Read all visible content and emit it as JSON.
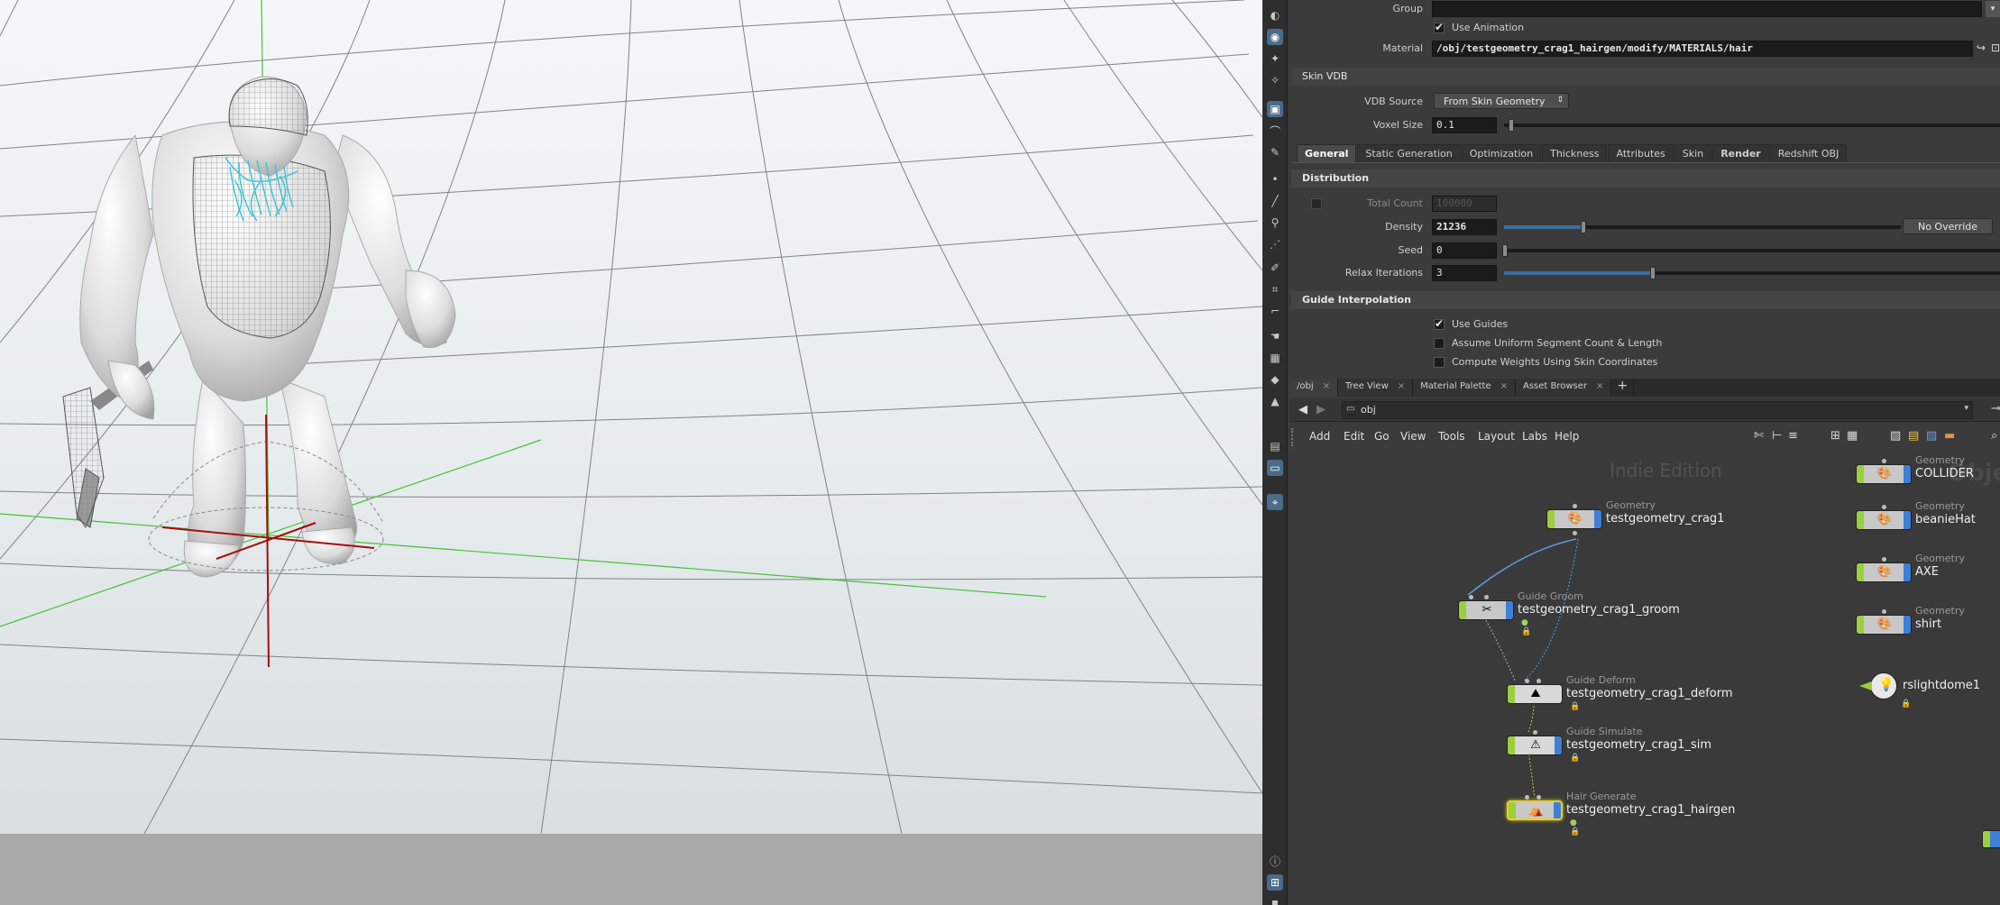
{
  "params": {
    "group_label": "Group",
    "use_animation_label": "Use Animation",
    "material_label": "Material",
    "material_value": "/obj/testgeometry_crag1_hairgen/modify/MATERIALS/hair",
    "skin_vdb_header": "Skin VDB",
    "vdb_source_label": "VDB Source",
    "vdb_source_value": "From Skin Geometry",
    "voxel_size_label": "Voxel Size",
    "voxel_size_value": "0.1",
    "tabs": [
      "General",
      "Static Generation",
      "Optimization",
      "Thickness",
      "Attributes",
      "Skin",
      "Render",
      "Redshift OBJ"
    ],
    "distribution_header": "Distribution",
    "total_count_label": "Total Count",
    "total_count_value": "100000",
    "density_label": "Density",
    "density_value": "21236",
    "density_fraction": 0.2,
    "no_override_label": "No Override",
    "seed_label": "Seed",
    "seed_value": "0",
    "relax_label": "Relax Iterations",
    "relax_value": "3",
    "relax_fraction": 0.3,
    "guide_interp_header": "Guide Interpolation",
    "use_guides_label": "Use Guides",
    "uniform_label": "Assume Uniform Segment Count & Length",
    "compute_weights_label": "Compute Weights Using Skin Coordinates"
  },
  "panetabs": [
    {
      "label": "/obj"
    },
    {
      "label": "Tree View"
    },
    {
      "label": "Material Palette"
    },
    {
      "label": "Asset Browser"
    }
  ],
  "add_tab": "+",
  "path": "obj",
  "menu": [
    "Add",
    "Edit",
    "Go",
    "View",
    "Tools",
    "Layout",
    "Labs",
    "Help"
  ],
  "network": {
    "watermark": "Indie Edition",
    "watermark2": "Objec",
    "nodes": [
      {
        "type": "Geometry",
        "name": "testgeometry_crag1"
      },
      {
        "type": "Guide Groom",
        "name": "testgeometry_crag1_groom"
      },
      {
        "type": "Guide Deform",
        "name": "testgeometry_crag1_deform"
      },
      {
        "type": "Guide Simulate",
        "name": "testgeometry_crag1_sim"
      },
      {
        "type": "Hair Generate",
        "name": "testgeometry_crag1_hairgen"
      },
      {
        "type": "Geometry",
        "name": "COLLIDER"
      },
      {
        "type": "Geometry",
        "name": "beanieHat"
      },
      {
        "type": "Geometry",
        "name": "AXE"
      },
      {
        "type": "Geometry",
        "name": "shirt"
      },
      {
        "type": "",
        "name": "rslightdome1"
      }
    ]
  }
}
